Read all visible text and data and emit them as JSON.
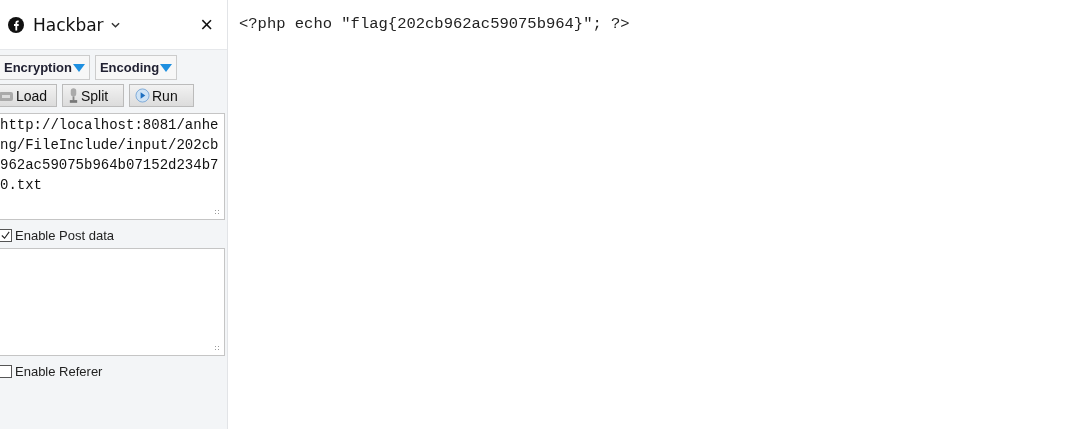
{
  "panel": {
    "title": "Hackbar",
    "close": "×"
  },
  "menus": [
    {
      "label": "Encryption"
    },
    {
      "label": "Encoding"
    }
  ],
  "buttons": [
    {
      "label": "Load",
      "kind": "load"
    },
    {
      "label": "Split",
      "kind": "split"
    },
    {
      "label": "Run",
      "kind": "run"
    }
  ],
  "url_field": {
    "value": "http://localhost:8081/anheng/FileInclude/input/202cb962ac59075b964b07152d234b70.txt"
  },
  "post_option": {
    "label": "Enable Post data",
    "checked": true
  },
  "referer_option": {
    "label": "Enable Referer",
    "checked": false
  },
  "page": {
    "text": "<?php echo \"flag{202cb962ac59075b964}\"; ?>"
  }
}
